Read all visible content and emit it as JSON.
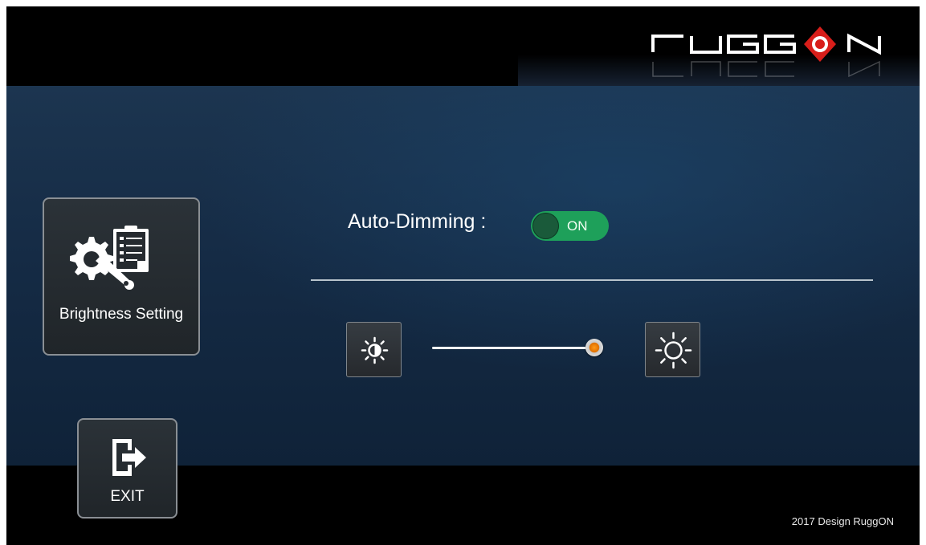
{
  "brand": {
    "logo_text": "RUGGON",
    "accent_color": "#e8231f"
  },
  "sidebar": {
    "brightness_tile": {
      "label": "Brightness Setting",
      "icon": "gear-wrench-clipboard-icon"
    },
    "exit_tile": {
      "label": "EXIT",
      "icon": "exit-door-arrow-icon"
    }
  },
  "settings": {
    "auto_dimming": {
      "label": "Auto-Dimming :",
      "state_text": "ON",
      "enabled": true,
      "color": "#1ea05a"
    },
    "brightness": {
      "decrease_icon": "sun-small-icon",
      "increase_icon": "sun-large-icon",
      "level": 0.96
    }
  },
  "footer": {
    "credit": "2017 Design RuggON"
  }
}
